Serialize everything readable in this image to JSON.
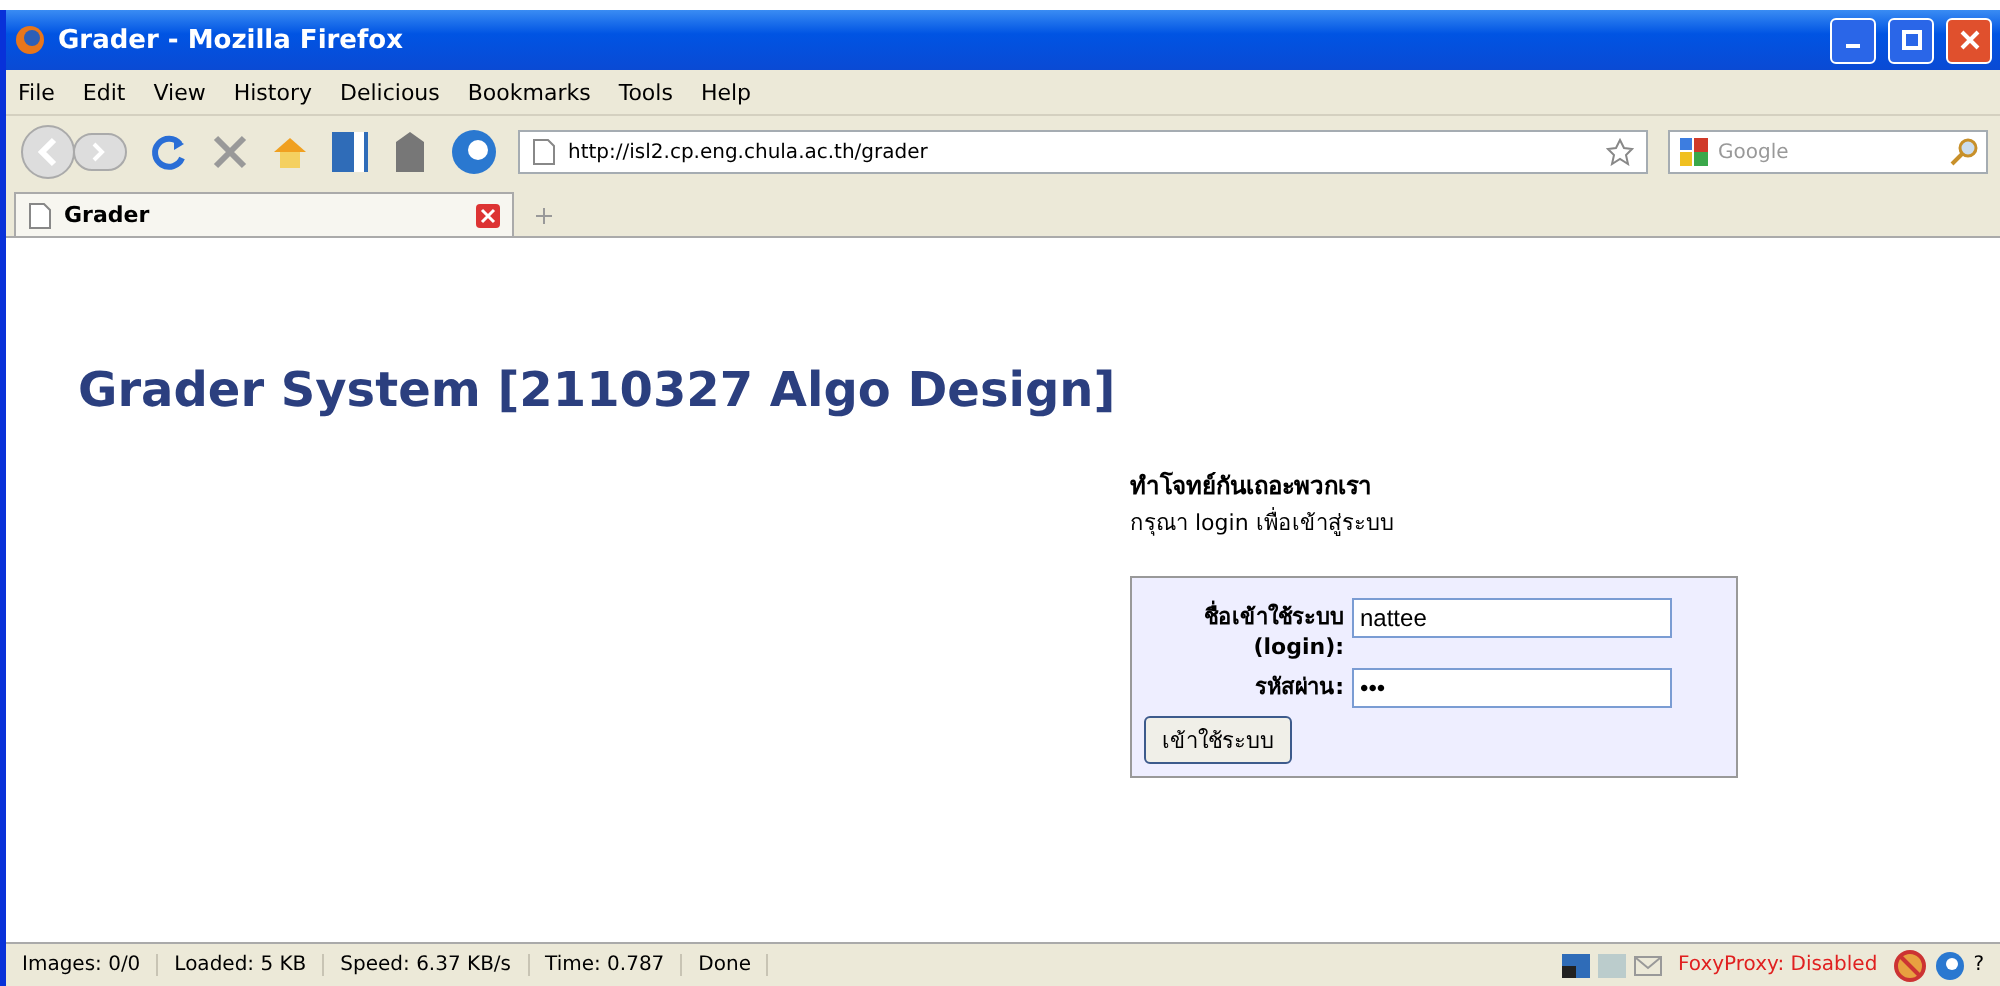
{
  "window": {
    "title": "Grader - Mozilla Firefox"
  },
  "menu": [
    "File",
    "Edit",
    "View",
    "History",
    "Delicious",
    "Bookmarks",
    "Tools",
    "Help"
  ],
  "address": {
    "value": "http://isl2.cp.eng.chula.ac.th/grader"
  },
  "search": {
    "placeholder": "Google"
  },
  "tabs": [
    {
      "label": "Grader",
      "selected": true
    }
  ],
  "page": {
    "heading": "Grader System [2110327 Algo Design]",
    "greeting": "ทำโจทย์กันเถอะพวกเรา",
    "instruction": "กรุณา login เพื่อเข้าสู่ระบบ",
    "login_label": "ชื่อเข้าใช้ระบบ (login):",
    "login_value": "nattee",
    "password_label": "รหัสผ่าน:",
    "password_value": "•••",
    "submit": "เข้าใช้ระบบ"
  },
  "status_bar": {
    "cells": [
      "Images: 0/0",
      "Loaded: 5 KB",
      "Speed: 6.37 KB/s",
      "Time: 0.787",
      "Done"
    ],
    "proxy": "FoxyProxy: Disabled",
    "help": "?"
  }
}
